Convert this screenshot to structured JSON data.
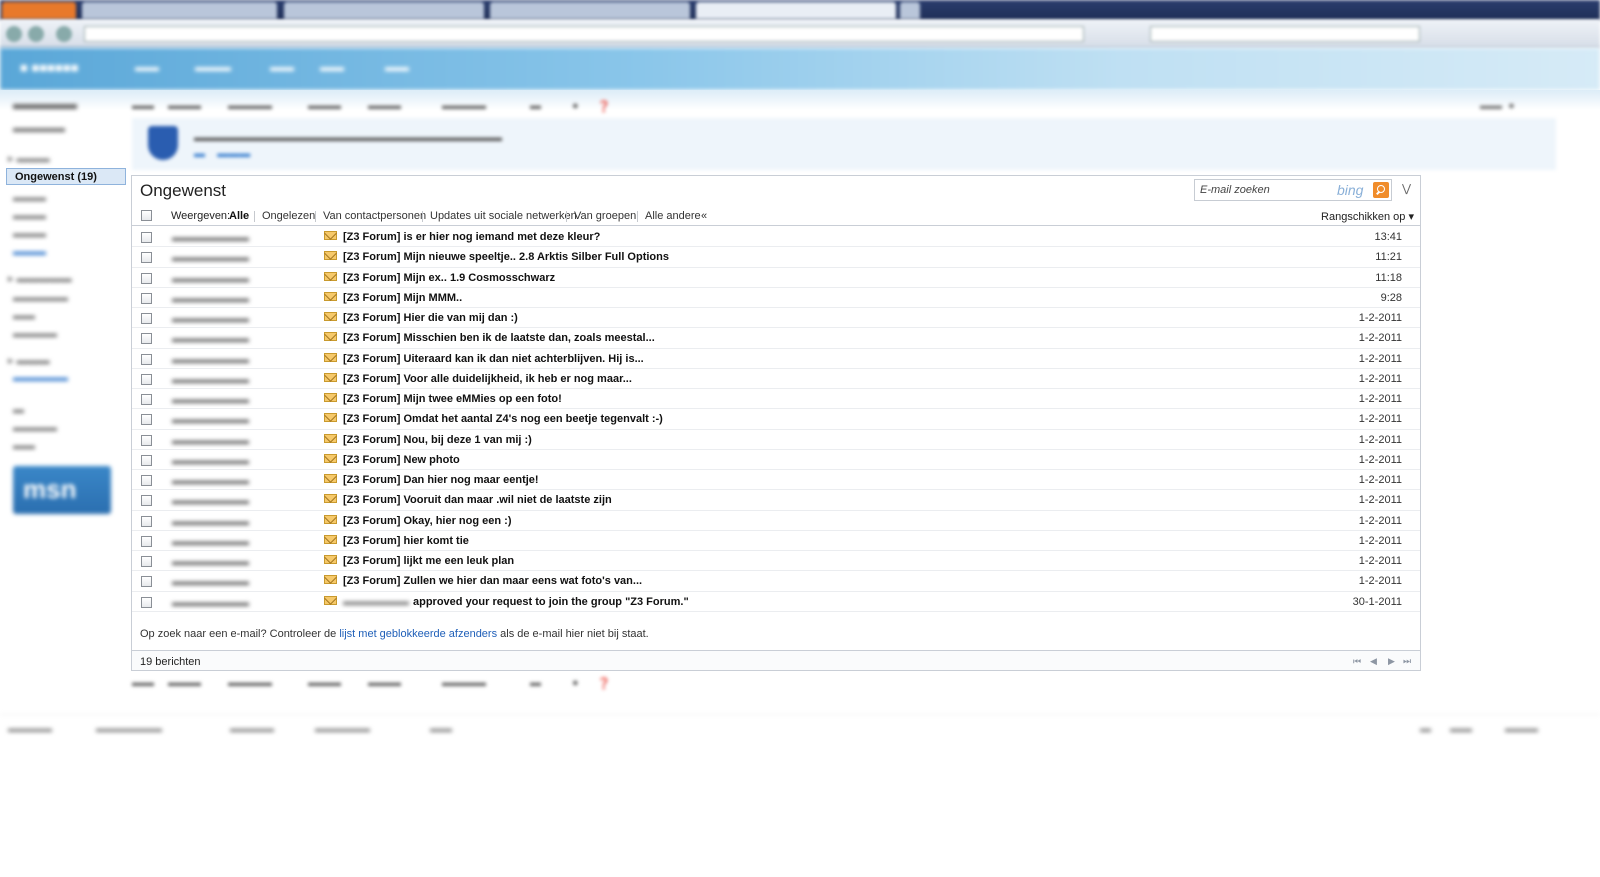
{
  "folder": {
    "title": "Ongewenst",
    "selected_label": "Ongewenst (19)"
  },
  "search": {
    "placeholder": "E-mail zoeken",
    "engine": "bing"
  },
  "filters": {
    "label": "Weergeven:",
    "items": [
      "Alle",
      "Ongelezen",
      "Van contactpersonen",
      "Updates uit sociale netwerken",
      "Van groepen",
      "Alle andere"
    ],
    "active": "Alle",
    "collapse": "«"
  },
  "sort": {
    "label": "Rangschikken op ▾"
  },
  "messages": [
    {
      "subject": "[Z3 Forum] is er hier nog iemand met deze kleur?",
      "date": "13:41"
    },
    {
      "subject": "[Z3 Forum] Mijn nieuwe speeltje.. 2.8 Arktis Silber Full Options",
      "date": "11:21"
    },
    {
      "subject": "[Z3 Forum] Mijn ex.. 1.9 Cosmosschwarz",
      "date": "11:18"
    },
    {
      "subject": "[Z3 Forum] Mijn MMM..",
      "date": "9:28"
    },
    {
      "subject": "[Z3 Forum] Hier die van mij dan :)",
      "date": "1-2-2011"
    },
    {
      "subject": "[Z3 Forum] Misschien ben ik de laatste dan, zoals meestal...",
      "date": "1-2-2011"
    },
    {
      "subject": "[Z3 Forum] Uiteraard kan ik dan niet achterblijven. Hij is...",
      "date": "1-2-2011"
    },
    {
      "subject": "[Z3 Forum] Voor alle duidelijkheid, ik heb er nog maar...",
      "date": "1-2-2011"
    },
    {
      "subject": "[Z3 Forum] Mijn twee eMMies op een foto!",
      "date": "1-2-2011"
    },
    {
      "subject": "[Z3 Forum] Omdat het aantal Z4's nog een beetje tegenvalt :-)",
      "date": "1-2-2011"
    },
    {
      "subject": "[Z3 Forum] Nou, bij deze 1 van mij :)",
      "date": "1-2-2011"
    },
    {
      "subject": "[Z3 Forum] New photo",
      "date": "1-2-2011"
    },
    {
      "subject": "[Z3 Forum] Dan hier nog maar eentje!",
      "date": "1-2-2011"
    },
    {
      "subject": "[Z3 Forum] Vooruit dan maar .wil niet de laatste zijn",
      "date": "1-2-2011"
    },
    {
      "subject": "[Z3 Forum] Okay, hier nog een :)",
      "date": "1-2-2011"
    },
    {
      "subject": "[Z3 Forum] hier komt tie",
      "date": "1-2-2011"
    },
    {
      "subject": "[Z3 Forum] lijkt me een leuk plan",
      "date": "1-2-2011"
    },
    {
      "subject": "[Z3 Forum] Zullen we hier dan maar eens wat foto's van...",
      "date": "1-2-2011"
    },
    {
      "subject": "approved your request to join the group \"Z3 Forum.\"",
      "date": "30-1-2011"
    }
  ],
  "notice": {
    "before": "Op zoek naar een e-mail? Controleer de ",
    "link": "lijst met geblokkeerde afzenders",
    "after": " als de e-mail hier niet bij staat."
  },
  "footer": {
    "count": "19 berichten"
  },
  "icons": [
    "search-icon",
    "envelope-icon",
    "first-page-icon",
    "prev-page-icon",
    "next-page-icon",
    "last-page-icon",
    "expand-icon",
    "shield-icon"
  ],
  "colors": {
    "accent": "#1f5fb8",
    "header": "#5aa7d8",
    "search_button": "#f08c2a",
    "envelope": "#f6c96a"
  }
}
